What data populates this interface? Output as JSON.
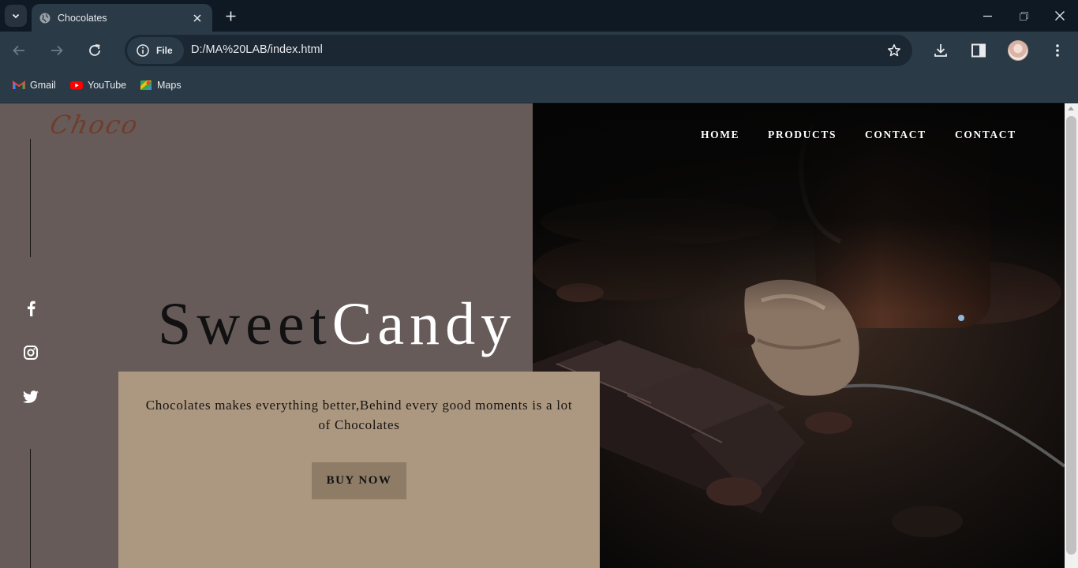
{
  "browser": {
    "tab_title": "Chocolates",
    "site_chip": "File",
    "url": "D:/MA%20LAB/index.html",
    "bookmarks": [
      {
        "label": "Gmail",
        "icon": "gmail-icon"
      },
      {
        "label": "YouTube",
        "icon": "youtube-icon"
      },
      {
        "label": "Maps",
        "icon": "maps-icon"
      }
    ]
  },
  "page": {
    "logo": "Choco",
    "nav": [
      "HOME",
      "PRODUCTS",
      "CONTACT",
      "CONTACT"
    ],
    "headline_dark": "Sweet",
    "headline_light": "Candy",
    "tagline": "Chocolates makes everything better,Behind every good moments is a lot of Chocolates",
    "button": "BUY NOW",
    "social": [
      "facebook-icon",
      "instagram-icon",
      "twitter-icon"
    ]
  },
  "colors": {
    "left_panel": "#675b5a",
    "card": "#ac9880",
    "button": "#8e7c67",
    "logo": "#6e3d2b"
  }
}
